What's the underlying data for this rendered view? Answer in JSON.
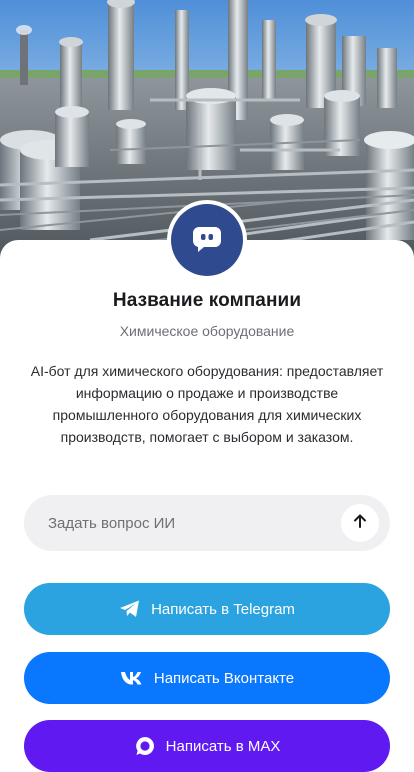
{
  "company": {
    "name": "Название компании",
    "subtitle": "Химическое оборудование",
    "description": "AI-бот для химического оборудования: предоставляет информацию о продаже и производстве промышленного оборудования для химических производств, помогает с выбором и заказом.",
    "avatar_icon": "chat-bot-icon"
  },
  "ask": {
    "placeholder": "Задать вопрос ИИ",
    "send_icon": "arrow-up-icon"
  },
  "buttons": {
    "telegram": {
      "label": "Написать в Telegram",
      "icon": "telegram-icon",
      "color": "#2aa3e0"
    },
    "vk": {
      "label": "Написать Вконтакте",
      "icon": "vk-icon",
      "color": "#0a77ff"
    },
    "max": {
      "label": "Написать в MAX",
      "icon": "max-icon",
      "color": "#6119f2"
    }
  },
  "colors": {
    "avatar_bg": "#2f4a8f",
    "ask_bg": "#f0f0f2"
  }
}
